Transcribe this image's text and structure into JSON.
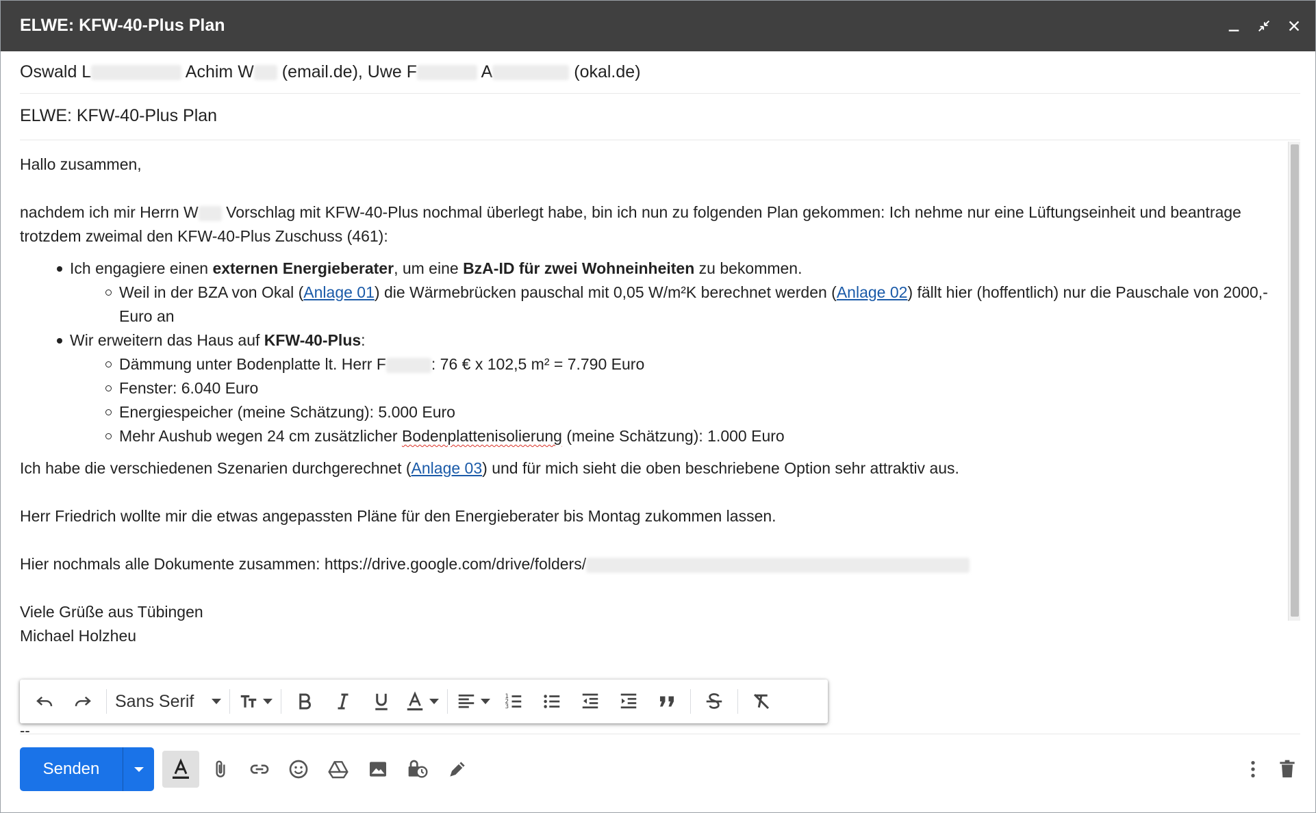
{
  "window": {
    "title": "ELWE: KFW-40-Plus Plan",
    "controls": [
      "minimize-icon",
      "exit-fullscreen-icon",
      "close-icon"
    ]
  },
  "recipients": {
    "r1": "Oswald L",
    "r2": "Achim W",
    "r2_domain": "(email.de),",
    "r3": "Uwe F",
    "r4": "A",
    "r4_domain": "(okal.de)"
  },
  "subject": "ELWE: KFW-40-Plus Plan",
  "body": {
    "greeting": "Hallo zusammen,",
    "intro_a": "nachdem ich mir Herrn W",
    "intro_b": " Vorschlag mit KFW-40-Plus nochmal überlegt habe, bin ich nun zu folgenden Plan gekommen: Ich nehme nur eine Lüftungseinheit und beantrage trotzdem zweimal den KFW-40-Plus Zuschuss (461):",
    "b1_a": "Ich engagiere einen ",
    "b1_b": "externen Energieberater",
    "b1_c": ", um eine ",
    "b1_d": "BzA-ID für zwei Wohneinheiten",
    "b1_e": " zu bekommen.",
    "b1s1_a": "Weil in der BZA von Okal (",
    "b1s1_link1": "Anlage 01",
    "b1s1_b": ") die Wärmebrücken pauschal mit 0,05 W/m²K berechnet werden (",
    "b1s1_link2": "Anlage 02",
    "b1s1_c": ") fällt hier (hoffentlich) nur die Pauschale von 2000,- Euro an",
    "b2_a": "Wir erweitern das Haus auf ",
    "b2_b": "KFW-40-Plus",
    "b2_c": ":",
    "b2s1_a": "Dämmung unter Bodenplatte lt. Herr F",
    "b2s1_b": ": 76 € x 102,5 m² = 7.790 Euro",
    "b2s2": "Fenster:  6.040 Euro",
    "b2s3": "Energiespeicher (meine Schätzung): 5.000 Euro",
    "b2s4_a": "Mehr Aushub wegen 24 cm zusätzlicher ",
    "b2s4_spell": "Bodenplattenisolierung",
    "b2s4_b": " (meine Schätzung): 1.000 Euro",
    "p2_a": "Ich habe die verschiedenen Szenarien durchgerechnet (",
    "p2_link": "Anlage 03",
    "p2_b": ") und für mich sieht die oben beschriebene Option sehr attraktiv aus.",
    "p3": "Herr Friedrich wollte mir die etwas angepassten Pläne für den Energieberater bis Montag zukommen lassen.",
    "p4": "Hier nochmals alle Dokumente zusammen: https://drive.google.com/drive/folders/",
    "closing": "Viele Grüße aus Tübingen",
    "signature": "Michael Holzheu",
    "sig_dash": "--"
  },
  "toolbar": {
    "font": "Sans Serif"
  },
  "actions": {
    "send_label": "Senden"
  },
  "colors": {
    "titlebar": "#404040",
    "send_button": "#1a73e8",
    "link": "#1a5aa8"
  }
}
